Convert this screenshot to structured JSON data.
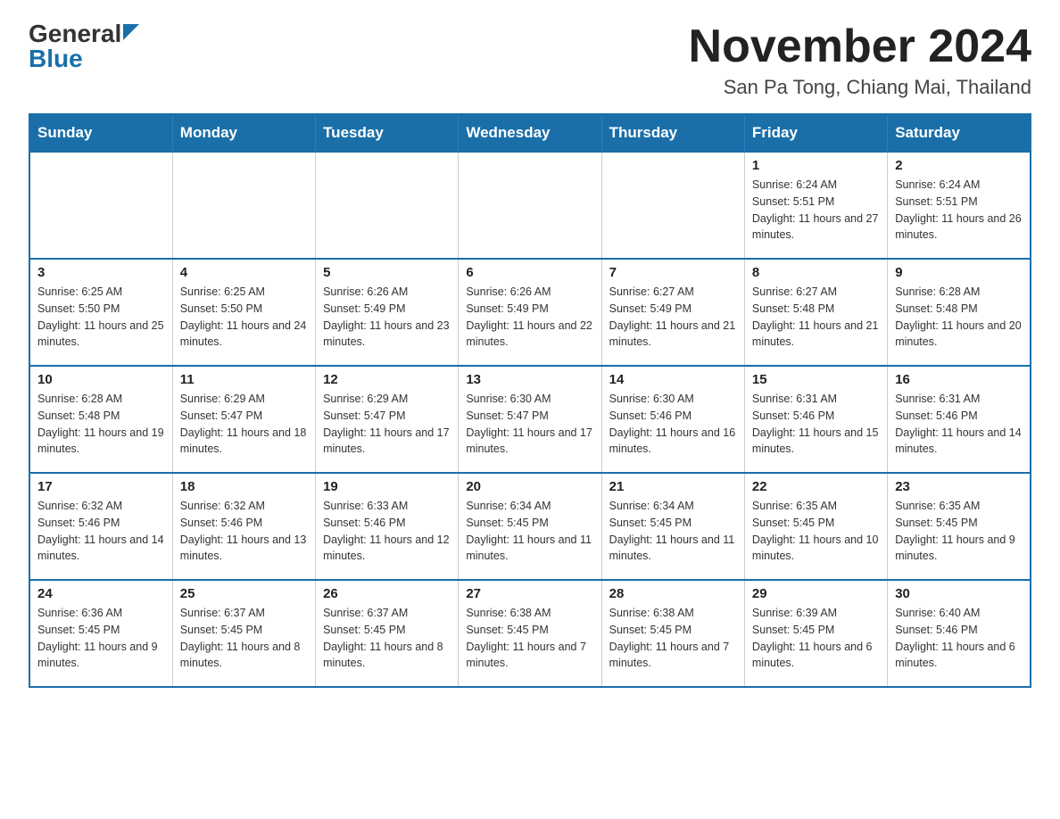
{
  "logo": {
    "general": "General",
    "blue": "Blue"
  },
  "header": {
    "month_year": "November 2024",
    "location": "San Pa Tong, Chiang Mai, Thailand"
  },
  "days_of_week": [
    "Sunday",
    "Monday",
    "Tuesday",
    "Wednesday",
    "Thursday",
    "Friday",
    "Saturday"
  ],
  "weeks": [
    [
      {
        "day": "",
        "info": ""
      },
      {
        "day": "",
        "info": ""
      },
      {
        "day": "",
        "info": ""
      },
      {
        "day": "",
        "info": ""
      },
      {
        "day": "",
        "info": ""
      },
      {
        "day": "1",
        "info": "Sunrise: 6:24 AM\nSunset: 5:51 PM\nDaylight: 11 hours and 27 minutes."
      },
      {
        "day": "2",
        "info": "Sunrise: 6:24 AM\nSunset: 5:51 PM\nDaylight: 11 hours and 26 minutes."
      }
    ],
    [
      {
        "day": "3",
        "info": "Sunrise: 6:25 AM\nSunset: 5:50 PM\nDaylight: 11 hours and 25 minutes."
      },
      {
        "day": "4",
        "info": "Sunrise: 6:25 AM\nSunset: 5:50 PM\nDaylight: 11 hours and 24 minutes."
      },
      {
        "day": "5",
        "info": "Sunrise: 6:26 AM\nSunset: 5:49 PM\nDaylight: 11 hours and 23 minutes."
      },
      {
        "day": "6",
        "info": "Sunrise: 6:26 AM\nSunset: 5:49 PM\nDaylight: 11 hours and 22 minutes."
      },
      {
        "day": "7",
        "info": "Sunrise: 6:27 AM\nSunset: 5:49 PM\nDaylight: 11 hours and 21 minutes."
      },
      {
        "day": "8",
        "info": "Sunrise: 6:27 AM\nSunset: 5:48 PM\nDaylight: 11 hours and 21 minutes."
      },
      {
        "day": "9",
        "info": "Sunrise: 6:28 AM\nSunset: 5:48 PM\nDaylight: 11 hours and 20 minutes."
      }
    ],
    [
      {
        "day": "10",
        "info": "Sunrise: 6:28 AM\nSunset: 5:48 PM\nDaylight: 11 hours and 19 minutes."
      },
      {
        "day": "11",
        "info": "Sunrise: 6:29 AM\nSunset: 5:47 PM\nDaylight: 11 hours and 18 minutes."
      },
      {
        "day": "12",
        "info": "Sunrise: 6:29 AM\nSunset: 5:47 PM\nDaylight: 11 hours and 17 minutes."
      },
      {
        "day": "13",
        "info": "Sunrise: 6:30 AM\nSunset: 5:47 PM\nDaylight: 11 hours and 17 minutes."
      },
      {
        "day": "14",
        "info": "Sunrise: 6:30 AM\nSunset: 5:46 PM\nDaylight: 11 hours and 16 minutes."
      },
      {
        "day": "15",
        "info": "Sunrise: 6:31 AM\nSunset: 5:46 PM\nDaylight: 11 hours and 15 minutes."
      },
      {
        "day": "16",
        "info": "Sunrise: 6:31 AM\nSunset: 5:46 PM\nDaylight: 11 hours and 14 minutes."
      }
    ],
    [
      {
        "day": "17",
        "info": "Sunrise: 6:32 AM\nSunset: 5:46 PM\nDaylight: 11 hours and 14 minutes."
      },
      {
        "day": "18",
        "info": "Sunrise: 6:32 AM\nSunset: 5:46 PM\nDaylight: 11 hours and 13 minutes."
      },
      {
        "day": "19",
        "info": "Sunrise: 6:33 AM\nSunset: 5:46 PM\nDaylight: 11 hours and 12 minutes."
      },
      {
        "day": "20",
        "info": "Sunrise: 6:34 AM\nSunset: 5:45 PM\nDaylight: 11 hours and 11 minutes."
      },
      {
        "day": "21",
        "info": "Sunrise: 6:34 AM\nSunset: 5:45 PM\nDaylight: 11 hours and 11 minutes."
      },
      {
        "day": "22",
        "info": "Sunrise: 6:35 AM\nSunset: 5:45 PM\nDaylight: 11 hours and 10 minutes."
      },
      {
        "day": "23",
        "info": "Sunrise: 6:35 AM\nSunset: 5:45 PM\nDaylight: 11 hours and 9 minutes."
      }
    ],
    [
      {
        "day": "24",
        "info": "Sunrise: 6:36 AM\nSunset: 5:45 PM\nDaylight: 11 hours and 9 minutes."
      },
      {
        "day": "25",
        "info": "Sunrise: 6:37 AM\nSunset: 5:45 PM\nDaylight: 11 hours and 8 minutes."
      },
      {
        "day": "26",
        "info": "Sunrise: 6:37 AM\nSunset: 5:45 PM\nDaylight: 11 hours and 8 minutes."
      },
      {
        "day": "27",
        "info": "Sunrise: 6:38 AM\nSunset: 5:45 PM\nDaylight: 11 hours and 7 minutes."
      },
      {
        "day": "28",
        "info": "Sunrise: 6:38 AM\nSunset: 5:45 PM\nDaylight: 11 hours and 7 minutes."
      },
      {
        "day": "29",
        "info": "Sunrise: 6:39 AM\nSunset: 5:45 PM\nDaylight: 11 hours and 6 minutes."
      },
      {
        "day": "30",
        "info": "Sunrise: 6:40 AM\nSunset: 5:46 PM\nDaylight: 11 hours and 6 minutes."
      }
    ]
  ]
}
